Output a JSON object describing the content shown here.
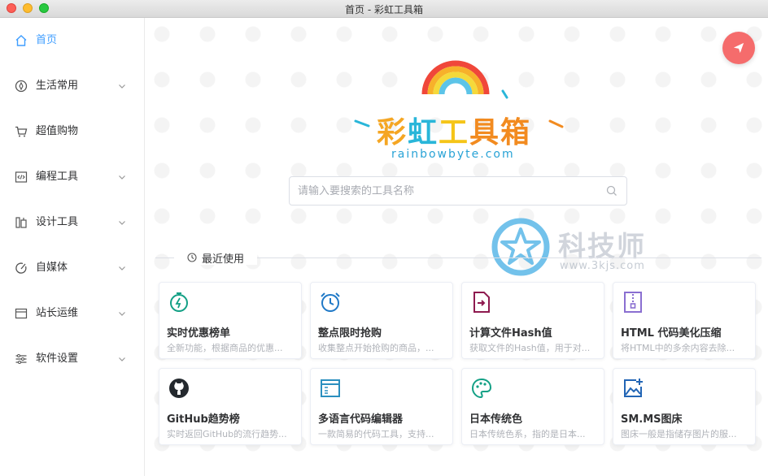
{
  "window": {
    "title": "首页 - 彩虹工具箱"
  },
  "sidebar": {
    "items": [
      {
        "label": "首页",
        "icon": "home-icon",
        "active": true
      },
      {
        "label": "生活常用",
        "icon": "compass-icon",
        "expandable": true
      },
      {
        "label": "超值购物",
        "icon": "cart-icon",
        "expandable": false
      },
      {
        "label": "编程工具",
        "icon": "code-icon",
        "expandable": true
      },
      {
        "label": "设计工具",
        "icon": "design-icon",
        "expandable": true
      },
      {
        "label": "自媒体",
        "icon": "media-icon",
        "expandable": true
      },
      {
        "label": "站长运维",
        "icon": "window-icon",
        "expandable": true
      },
      {
        "label": "软件设置",
        "icon": "sliders-icon",
        "expandable": true
      }
    ]
  },
  "logo": {
    "chars": [
      "彩",
      "虹",
      "工",
      "具箱"
    ],
    "domain": "rainbowbyte.com"
  },
  "search": {
    "placeholder": "请输入要搜索的工具名称",
    "value": ""
  },
  "watermark": {
    "text": "科技师",
    "url": "www.3kjs.com"
  },
  "recent": {
    "label": "最近使用",
    "cards": [
      {
        "title": "实时优惠榜单",
        "desc": "全新功能，根据商品的优惠...",
        "icon": "stopwatch-icon",
        "color": "#13a085"
      },
      {
        "title": "整点限时抢购",
        "desc": "收集整点开始抢购的商品，...",
        "icon": "alarm-clock-icon",
        "color": "#2079c7"
      },
      {
        "title": "计算文件Hash值",
        "desc": "获取文件的Hash值，用于对...",
        "icon": "file-import-icon",
        "color": "#8e1a4f"
      },
      {
        "title": "HTML 代码美化压缩",
        "desc": "将HTML中的多余内容去除...",
        "icon": "zip-file-icon",
        "color": "#8a6fd1"
      },
      {
        "title": "GitHub趋势榜",
        "desc": "实时返回GitHub的流行趋势...",
        "icon": "github-icon",
        "color": "#24292e"
      },
      {
        "title": "多语言代码编辑器",
        "desc": "一款简易的代码工具，支持...",
        "icon": "code-window-icon",
        "color": "#2b8fbf"
      },
      {
        "title": "日本传统色",
        "desc": "日本传统色系，指的是日本...",
        "icon": "palette-icon",
        "color": "#13a085"
      },
      {
        "title": "SM.MS图床",
        "desc": "图床一般是指储存图片的服...",
        "icon": "image-add-icon",
        "color": "#2265b5"
      }
    ]
  },
  "colors": {
    "accent": "#409eff",
    "fab": "#f56c6c"
  }
}
